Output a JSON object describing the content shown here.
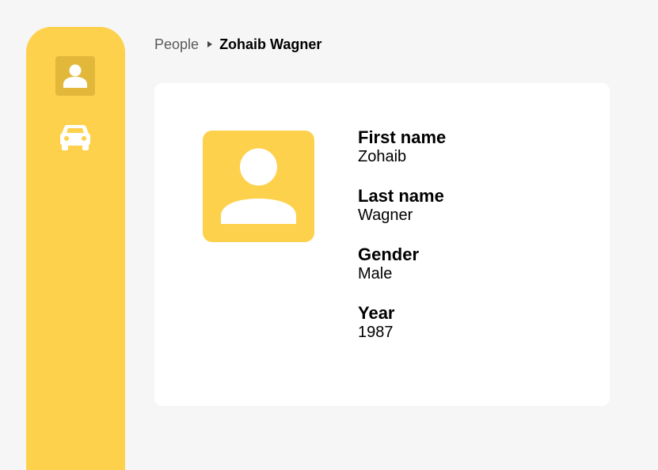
{
  "sidebar": {
    "items": [
      {
        "name": "people",
        "icon": "person-icon",
        "active": true
      },
      {
        "name": "cars",
        "icon": "car-icon",
        "active": false
      }
    ]
  },
  "breadcrumb": {
    "parent": "People",
    "current": "Zohaib Wagner",
    "separator_icon": "caret-right-icon"
  },
  "profile": {
    "avatar_icon": "person-avatar-icon",
    "fields": [
      {
        "label": "First name",
        "value": "Zohaib"
      },
      {
        "label": "Last name",
        "value": "Wagner"
      },
      {
        "label": "Gender",
        "value": "Male"
      },
      {
        "label": "Year",
        "value": "1987"
      }
    ]
  },
  "colors": {
    "accent": "#fdd14c",
    "accent_active": "#e2b83b",
    "background": "#f6f6f6",
    "card": "#ffffff"
  }
}
